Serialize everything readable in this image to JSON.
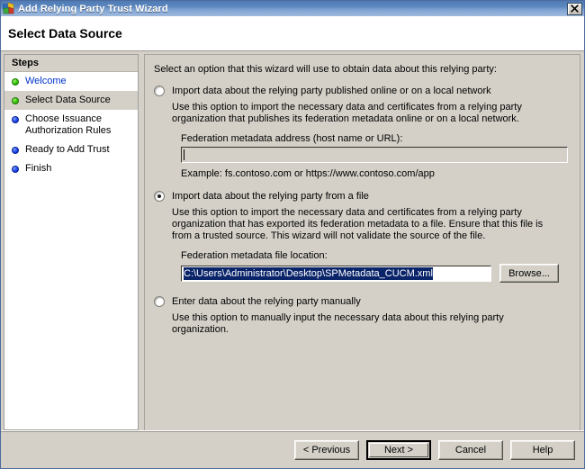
{
  "window": {
    "title": "Add Relying Party Trust Wizard",
    "icon": "wizard-icon",
    "close_label": "x"
  },
  "header": {
    "title": "Select Data Source"
  },
  "sidebar": {
    "header": "Steps",
    "items": [
      {
        "label": "Welcome",
        "bullet": "green",
        "state": "done"
      },
      {
        "label": "Select Data Source",
        "bullet": "green",
        "state": "current"
      },
      {
        "label": "Choose Issuance Authorization Rules",
        "bullet": "blue",
        "state": "pending"
      },
      {
        "label": "Ready to Add Trust",
        "bullet": "blue",
        "state": "pending"
      },
      {
        "label": "Finish",
        "bullet": "blue",
        "state": "pending"
      }
    ]
  },
  "main": {
    "intro": "Select an option that this wizard will use to obtain data about this relying party:",
    "options": [
      {
        "label": "Import data about the relying party published online or on a local network",
        "selected": false,
        "description": "Use this option to import the necessary data and certificates from a relying party organization that publishes its federation metadata online or on a local network.",
        "field_label": "Federation metadata address (host name or URL):",
        "field_value": "",
        "field_placeholder": "",
        "example": "Example: fs.contoso.com or https://www.contoso.com/app"
      },
      {
        "label": "Import data about the relying party from a file",
        "selected": true,
        "description": "Use this option to import the necessary data and certificates from a relying party organization that has exported its federation metadata to a file. Ensure that this file is from a trusted source.  This wizard will not validate the source of the file.",
        "field_label": "Federation metadata file location:",
        "field_value": "C:\\Users\\Administrator\\Desktop\\SPMetadata_CUCM.xml",
        "browse_label": "Browse..."
      },
      {
        "label": "Enter data about the relying party manually",
        "selected": false,
        "description": "Use this option to manually input the necessary data about this relying party organization."
      }
    ]
  },
  "footer": {
    "previous_label": "< Previous",
    "next_label": "Next >",
    "cancel_label": "Cancel",
    "help_label": "Help"
  },
  "colors": {
    "title_bar": "#5d88bf",
    "dialog_face": "#d4d0c8",
    "selection_blue": "#0a246a",
    "link_blue": "#0033cc",
    "bullet_green": "#36c20a",
    "bullet_blue": "#1d45f0"
  }
}
